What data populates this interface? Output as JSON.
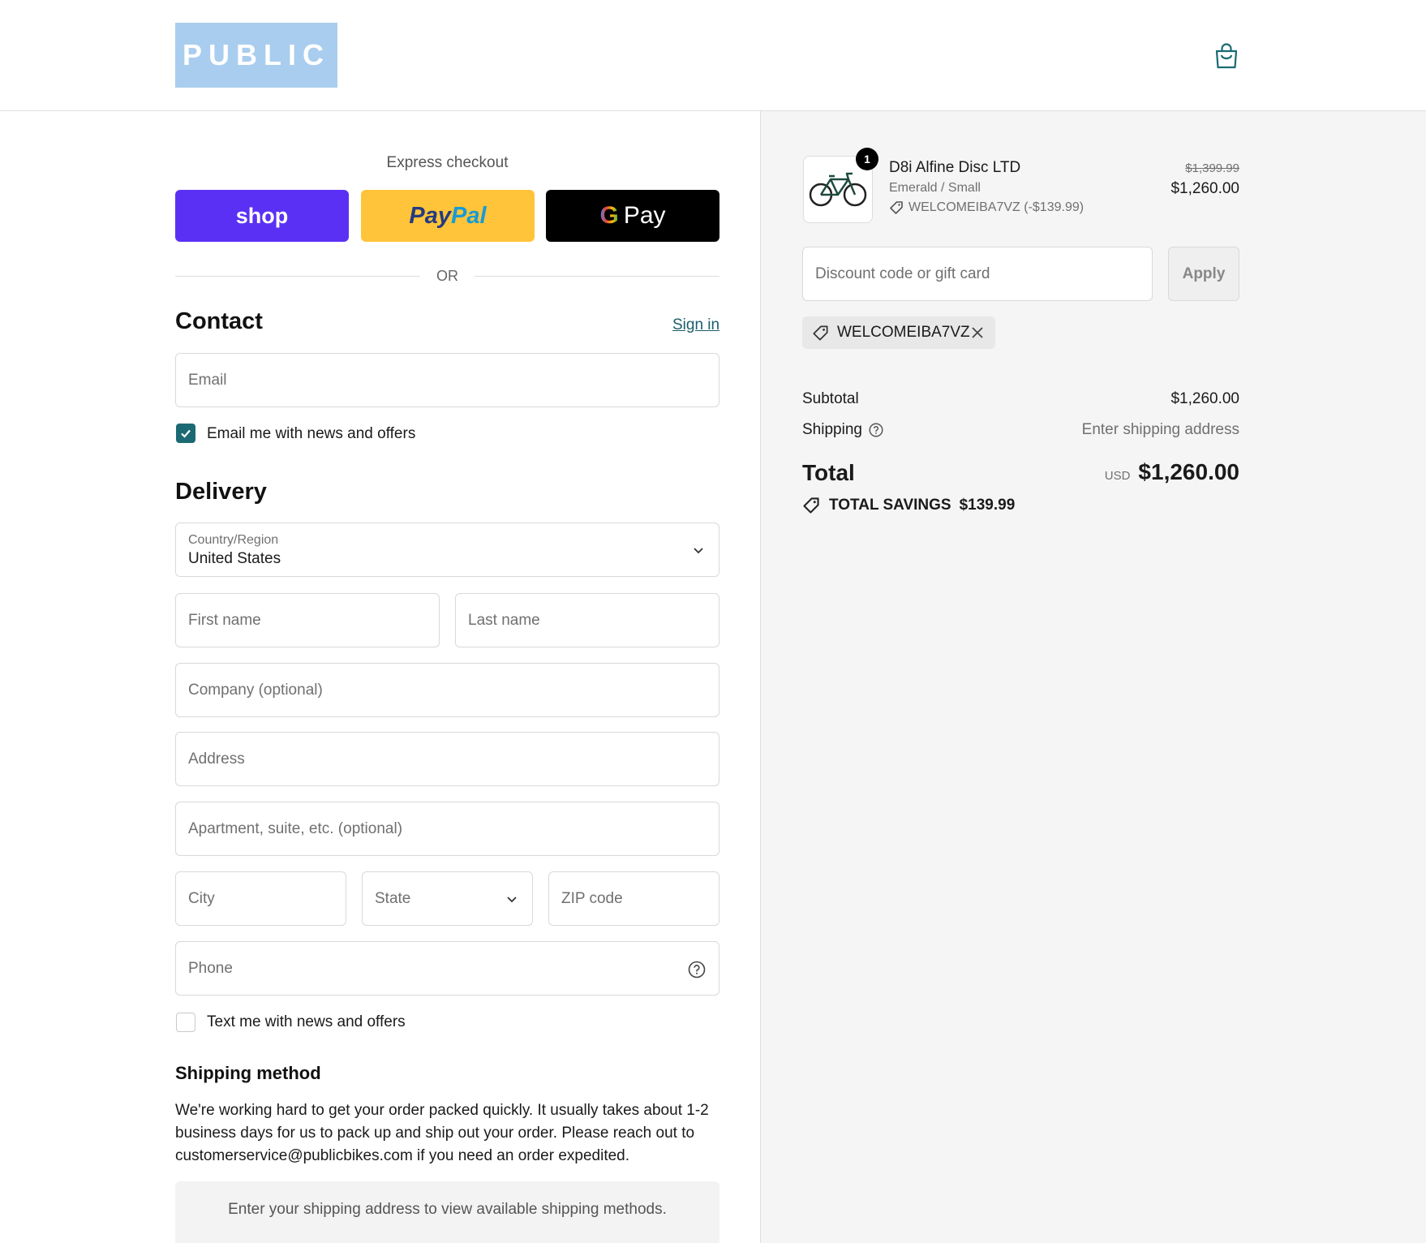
{
  "header": {
    "logo_text": "PUBLIC"
  },
  "express": {
    "label": "Express checkout",
    "shop_label": "shop",
    "paypal_label_1": "Pay",
    "paypal_label_2": "Pal",
    "gpay_g": "G",
    "gpay_label": "Pay",
    "or_label": "OR"
  },
  "contact": {
    "heading": "Contact",
    "sign_in": "Sign in",
    "email_placeholder": "Email",
    "news_label": "Email me with news and offers",
    "news_checked": true
  },
  "delivery": {
    "heading": "Delivery",
    "country_label": "Country/Region",
    "country_value": "United States",
    "first_name": "First name",
    "last_name": "Last name",
    "company": "Company (optional)",
    "address": "Address",
    "apartment": "Apartment, suite, etc. (optional)",
    "city": "City",
    "state": "State",
    "zip": "ZIP code",
    "phone": "Phone",
    "text_label": "Text me with news and offers",
    "text_checked": false
  },
  "shipping_method": {
    "heading": "Shipping method",
    "note": "We're working hard to get your order packed quickly. It usually takes about 1-2 business days for us to pack up and ship out your order. Please reach out to customerservice@publicbikes.com if you need an order expedited.",
    "placeholder": "Enter your shipping address to view available shipping methods."
  },
  "summary": {
    "item": {
      "quantity": "1",
      "name": "D8i Alfine Disc LTD",
      "variant": "Emerald / Small",
      "discount": "WELCOMEIBA7VZ (-$139.99)",
      "original_price": "$1,399.99",
      "price": "$1,260.00"
    },
    "discount_placeholder": "Discount code or gift card",
    "apply_label": "Apply",
    "applied_code": "WELCOMEIBA7VZ",
    "subtotal_label": "Subtotal",
    "subtotal_value": "$1,260.00",
    "shipping_label": "Shipping",
    "shipping_value": "Enter shipping address",
    "total_label": "Total",
    "currency": "USD",
    "total_value": "$1,260.00",
    "savings_label": "TOTAL SAVINGS",
    "savings_value": "$139.99"
  },
  "colors": {
    "accent": "#1b6a73",
    "shop": "#5a31f4",
    "paypal": "#ffc439",
    "logo_bg": "#a9cdee"
  }
}
